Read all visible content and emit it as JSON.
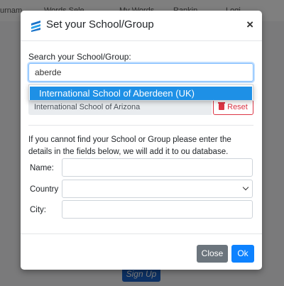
{
  "background": {
    "nav_fragments": [
      "urnam",
      "Words Sele",
      "My Words",
      "Rankin",
      "Logi"
    ],
    "signup_label": "Sign Up"
  },
  "modal": {
    "title": "Set your School/Group",
    "close_symbol": "×",
    "logo_icon": "school-logo-icon",
    "search": {
      "label": "Search your School/Group:",
      "value": "aberde",
      "placeholder": ""
    },
    "dropdown": {
      "items": [
        "International School of Aberdeen (UK)"
      ]
    },
    "selected_school": "International School of Arizona",
    "reset_label": "Reset",
    "info_text": "If you cannot find your School or Group please enter the details in the fields below, we will add it to ou database.",
    "fields": {
      "name_label": "Name:",
      "country_label": "Country",
      "city_label": "City:"
    },
    "footer": {
      "close_label": "Close",
      "ok_label": "Ok"
    }
  },
  "colors": {
    "primary": "#0d82ff",
    "secondary": "#6c757d",
    "danger": "#dc3545",
    "highlight": "#1e90e6"
  }
}
